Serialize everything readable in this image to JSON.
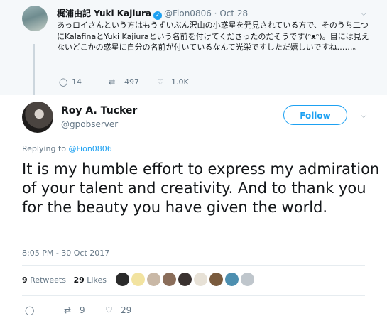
{
  "original_tweet": {
    "author_name": "梶浦由記 Yuki Kajiura",
    "handle": "@Fion0806",
    "date": "Oct 28",
    "text": "あっロイさんという方はもうずいぶん沢山の小惑星を発見されている方で、そのうち二つにKalafinaとYuki Kajiuraという名前を付けてくださったのだそうです(ᵔᴥᵔ)。目には見えないどこかの惑星に自分の名前が付いているなんて光栄ですしただ嬉しいですね……。",
    "replies": "14",
    "retweets": "497",
    "likes": "1.0K"
  },
  "reply_tweet": {
    "author_name": "Roy A. Tucker",
    "handle": "@gpobserver",
    "follow_label": "Follow",
    "replying_to_label": "Replying to",
    "replying_to_handle": "@Fion0806",
    "text": "It is my humble effort to express my admiration of your talent and creativity. And to thank you for the beauty you have given the world.",
    "timestamp": "8:05 PM - 30 Oct 2017",
    "retweets_count": "9",
    "retweets_label": "Retweets",
    "likes_count": "29",
    "likes_label": "Likes",
    "action_retweets": "9",
    "action_likes": "29"
  },
  "colors": {
    "accent": "#1da1f2",
    "muted": "#657786",
    "background_top": "#f5f8fa"
  },
  "icons": [
    "verified-badge-icon",
    "chevron-down-icon",
    "reply-icon",
    "retweet-icon",
    "like-icon"
  ]
}
